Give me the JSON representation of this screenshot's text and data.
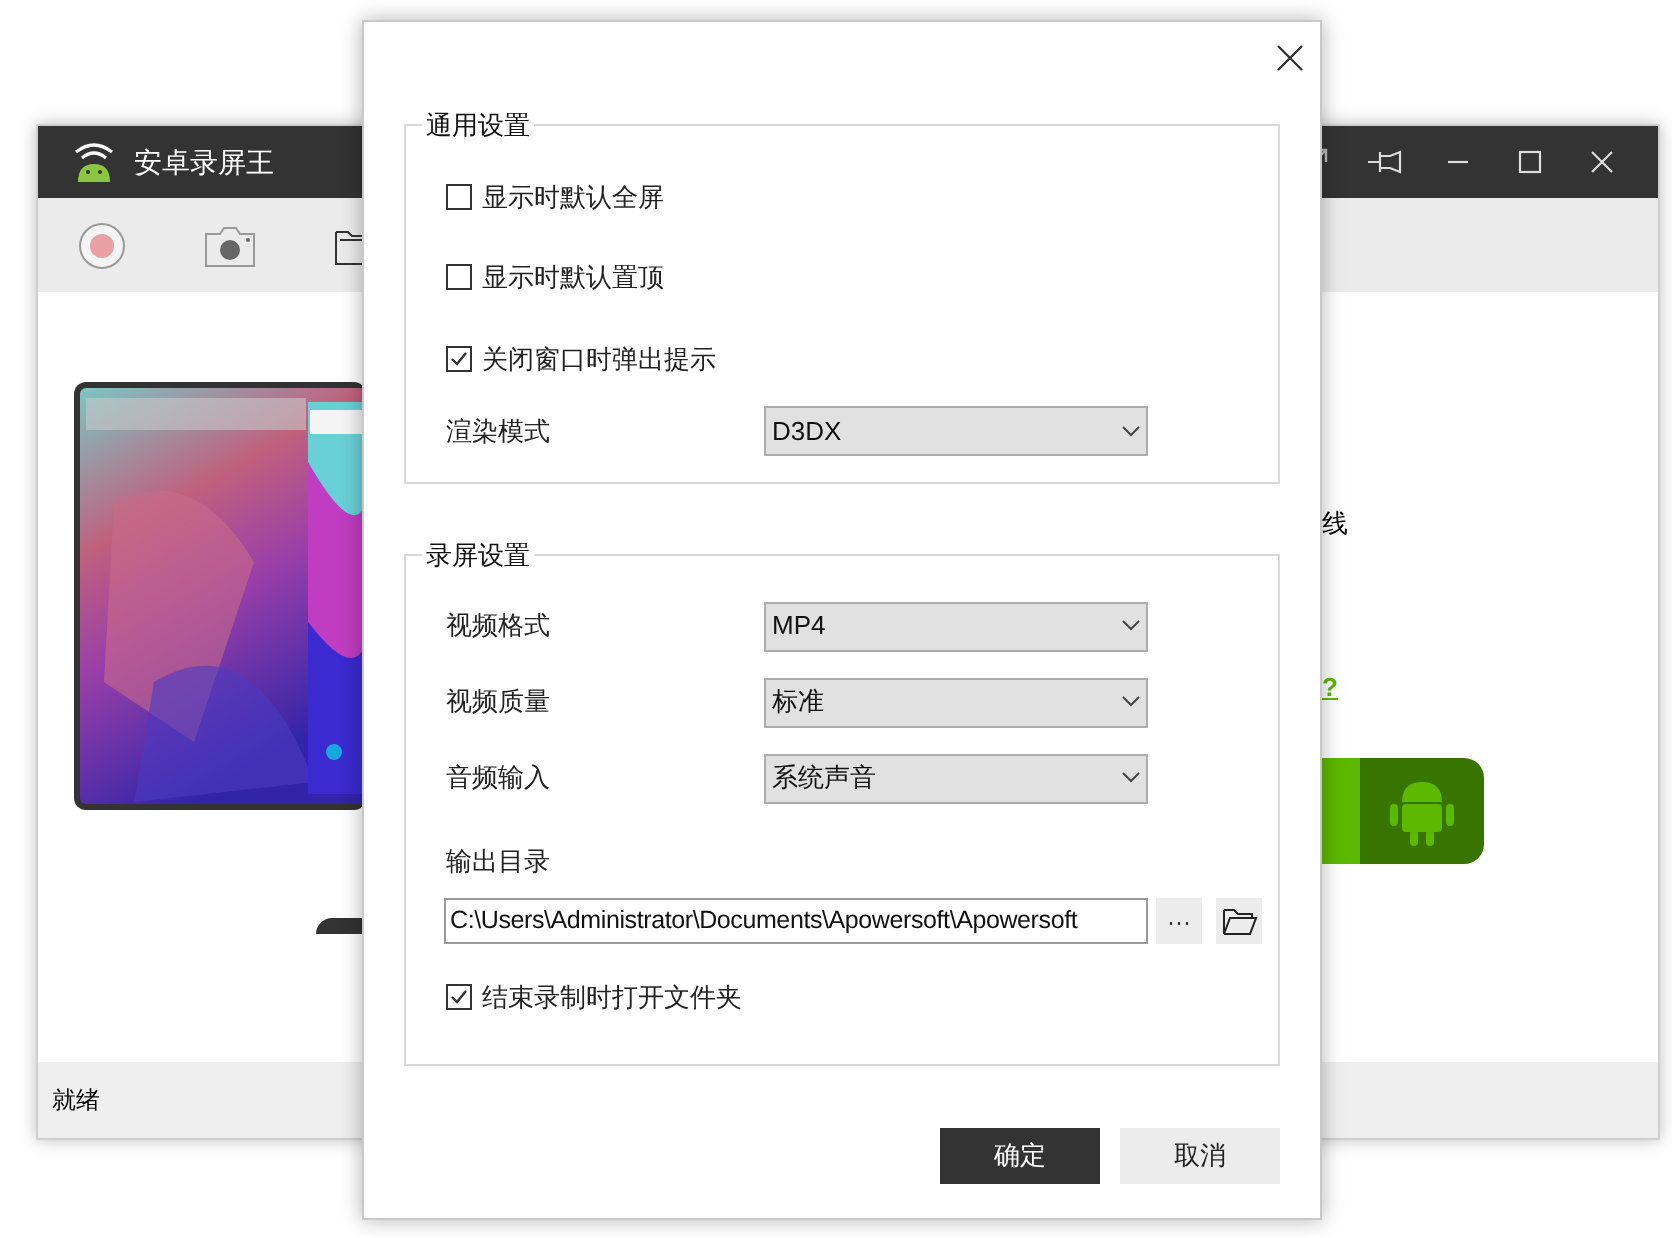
{
  "main_window": {
    "title": "安卓录屏王",
    "content_text": "线",
    "help_link": "?",
    "status_bar": "就绪"
  },
  "dialog": {
    "general": {
      "title": "通用设置",
      "checkboxes": [
        {
          "label": "显示时默认全屏",
          "checked": false
        },
        {
          "label": "显示时默认置顶",
          "checked": false
        },
        {
          "label": "关闭窗口时弹出提示",
          "checked": true
        }
      ],
      "render_mode": {
        "label": "渲染模式",
        "value": "D3DX"
      }
    },
    "recording": {
      "title": "录屏设置",
      "selects": [
        {
          "label": "视频格式",
          "value": "MP4"
        },
        {
          "label": "视频质量",
          "value": "标准"
        },
        {
          "label": "音频输入",
          "value": "系统声音"
        }
      ],
      "output": {
        "label": "输出目录",
        "value": "C:\\Users\\Administrator\\Documents\\Apowersoft\\Apowersoft",
        "browse": "···"
      },
      "open_folder": {
        "label": "结束录制时打开文件夹",
        "checked": true
      }
    },
    "buttons": [
      {
        "label": "确定",
        "kind": "primary"
      },
      {
        "label": "取消",
        "kind": "secondary"
      }
    ]
  }
}
